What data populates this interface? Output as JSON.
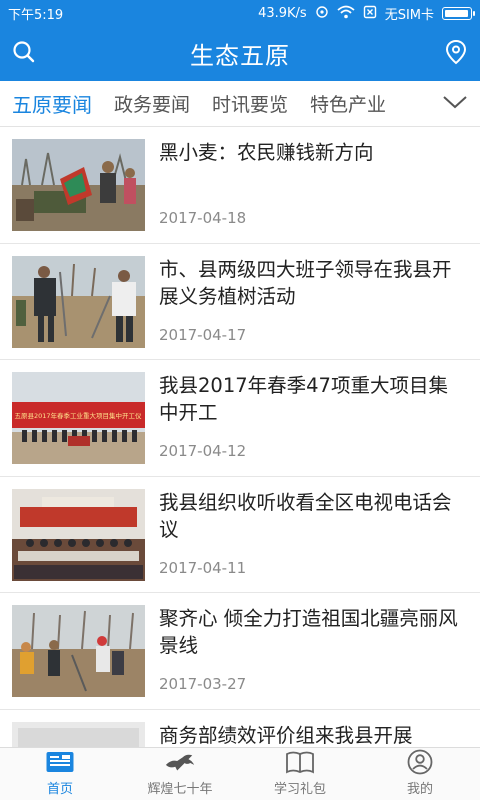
{
  "status_bar": {
    "time": "下午5:19",
    "speed": "43.9K/s",
    "sim": "无SIM卡",
    "battery_level": 0.95
  },
  "header": {
    "title": "生态五原",
    "search_icon": "search-icon",
    "location_icon": "location-pin-icon"
  },
  "tabs": [
    {
      "label": "五原要闻",
      "active": true
    },
    {
      "label": "政务要闻",
      "active": false
    },
    {
      "label": "时讯要览",
      "active": false
    },
    {
      "label": "特色产业",
      "active": false
    }
  ],
  "news": [
    {
      "title": "黑小麦：农民赚钱新方向",
      "date": "2017-04-18",
      "thumb_text": ""
    },
    {
      "title": "市、县两级四大班子领导在我县开展义务植树活动",
      "date": "2017-04-17",
      "thumb_text": ""
    },
    {
      "title": "我县2017年春季47项重大项目集中开工",
      "date": "2017-04-12",
      "thumb_text": "五原县2017年春季工业重大项目集中开工仪"
    },
    {
      "title": "我县组织收听收看全区电视电话会议",
      "date": "2017-04-11",
      "thumb_text": ""
    },
    {
      "title": "聚齐心 倾全力打造祖国北疆亮丽风景线",
      "date": "2017-03-27",
      "thumb_text": ""
    },
    {
      "title": "商务部绩效评价组来我县开展",
      "date": "",
      "thumb_text": ""
    }
  ],
  "bottom_nav": [
    {
      "label": "首页",
      "icon": "home-news-icon",
      "active": true
    },
    {
      "label": "辉煌七十年",
      "icon": "horse-icon",
      "active": false
    },
    {
      "label": "学习礼包",
      "icon": "book-icon",
      "active": false
    },
    {
      "label": "我的",
      "icon": "user-icon",
      "active": false
    }
  ],
  "colors": {
    "primary": "#1a85df",
    "text": "#222222",
    "muted": "#8a8a8a"
  }
}
